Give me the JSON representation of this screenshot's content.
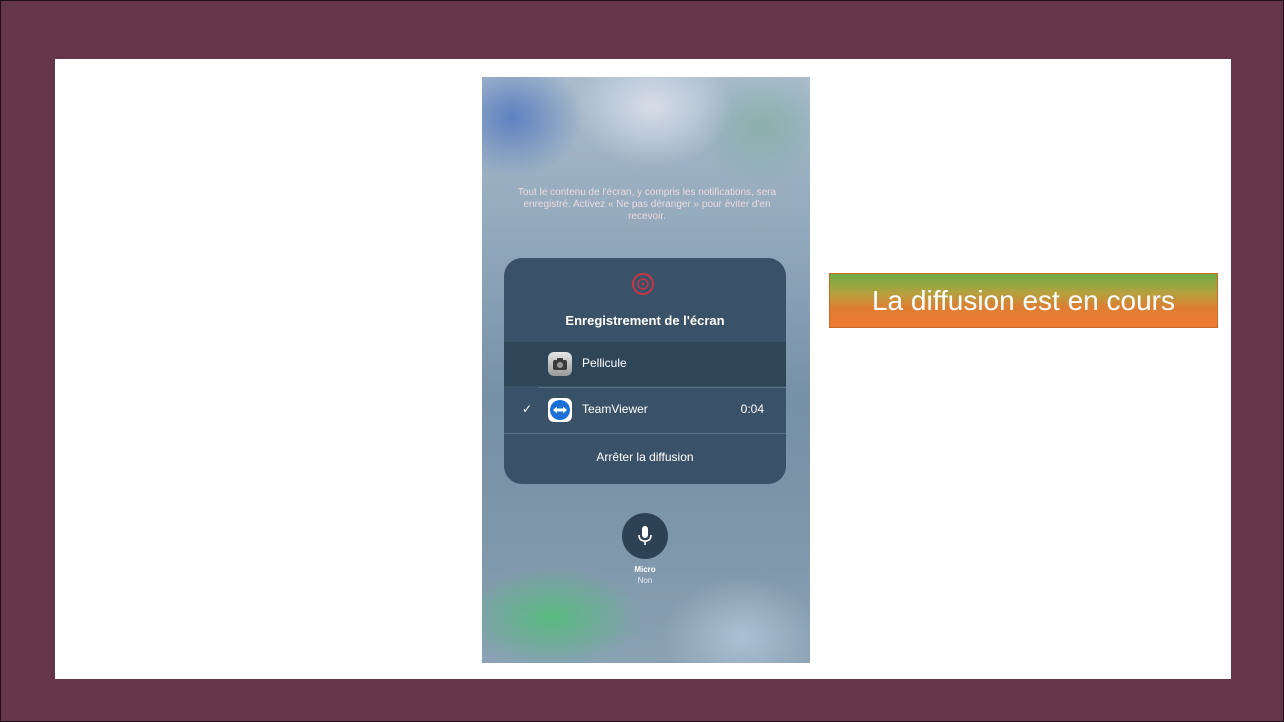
{
  "caption": "La diffusion est en cours",
  "phone": {
    "notice": "Tout le contenu de l'écran, y compris les notifications, sera enregistré. Activez « Ne pas déranger » pour éviter d'en recevoir.",
    "panel": {
      "title": "Enregistrement de l'écran",
      "options": [
        {
          "label": "Pellicule",
          "icon": "camera-icon",
          "selected": false
        },
        {
          "label": "TeamViewer",
          "icon": "teamviewer-icon",
          "selected": true,
          "check": "✓",
          "time": "0:04"
        }
      ],
      "stop_label": "Arrêter la diffusion"
    },
    "mic": {
      "label": "Micro",
      "status": "Non"
    }
  },
  "colors": {
    "frame": "#653649",
    "caption_orange": "#ec7b2f",
    "caption_green": "#6cab46",
    "record_red": "#c83545"
  }
}
